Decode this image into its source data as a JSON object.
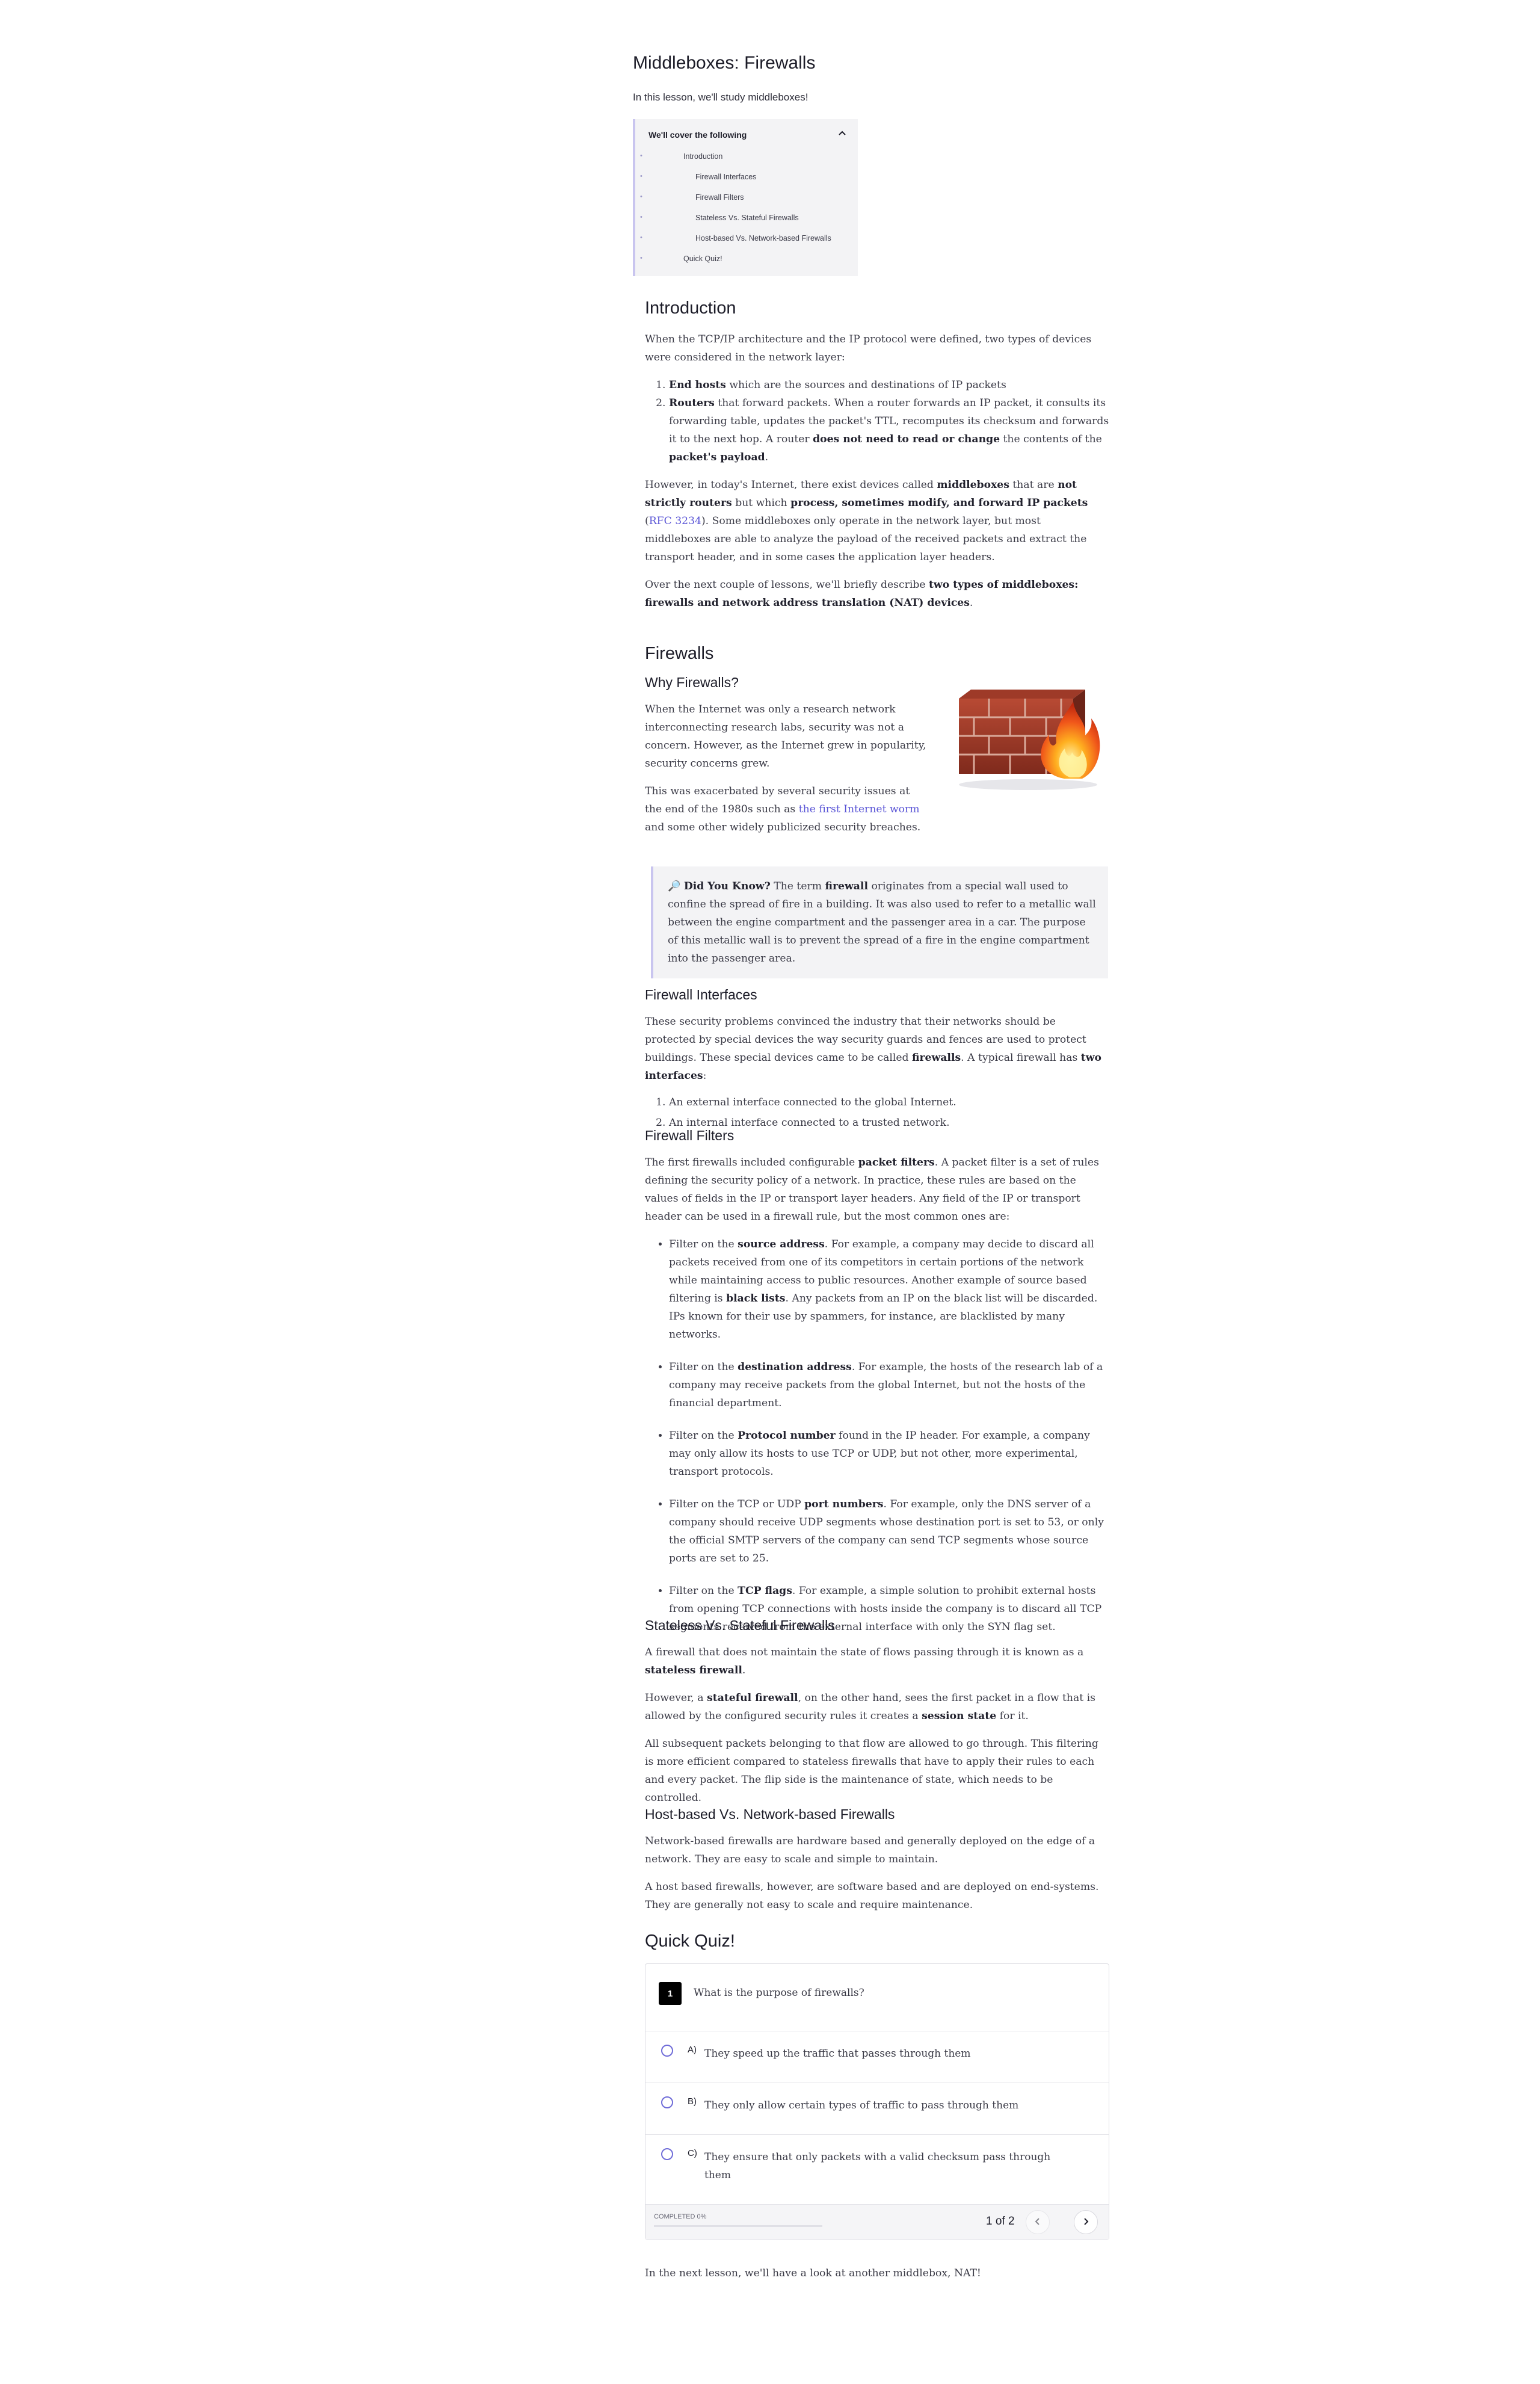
{
  "lesson": {
    "title": "Middleboxes: Firewalls",
    "subtitle": "In this lesson, we'll study middleboxes!"
  },
  "toc": {
    "heading": "We'll cover the following",
    "items": [
      {
        "label": "Introduction",
        "level": 1
      },
      {
        "label": "Firewall Interfaces",
        "level": 2
      },
      {
        "label": "Firewall Filters",
        "level": 2
      },
      {
        "label": "Stateless Vs. Stateful Firewalls",
        "level": 2
      },
      {
        "label": "Host-based Vs. Network-based Firewalls",
        "level": 2
      },
      {
        "label": "Quick Quiz!",
        "level": 1
      }
    ]
  },
  "intro": {
    "heading": "Introduction",
    "p1": "When the TCP/IP architecture and the IP protocol were defined, two types of devices were considered in the network layer:",
    "li1_b": "End hosts",
    "li1": " which are the sources and destinations of IP packets",
    "li2_b": "Routers",
    "li2a": " that forward packets. When a router forwards an IP packet, it consults its forwarding table, updates the packet's TTL, recomputes its checksum and forwards it to the next hop. A router ",
    "li2_b2": "does not need to read or change",
    "li2b": " the contents of the ",
    "li2_b3": "packet's payload",
    "li2c": ".",
    "p2a": "However, in today's Internet, there exist devices called ",
    "p2_b1": "middleboxes",
    "p2b": " that are ",
    "p2_b2": "not strictly routers",
    "p2c": " but which ",
    "p2_b3": "process, sometimes modify, and forward IP packets",
    "p2d": " (",
    "p2_link": "RFC 3234",
    "p2e": "). Some middleboxes only operate in the network layer, but most middleboxes are able to analyze the payload of the received packets and extract the transport header, and in some cases the application layer headers.",
    "p3a": "Over the next couple of lessons, we'll briefly describe ",
    "p3_b": "two types of middleboxes: firewalls and network address translation (NAT) devices",
    "p3b": "."
  },
  "firewalls": {
    "heading": "Firewalls",
    "why_heading": "Why Firewalls?",
    "why_p1": "When the Internet was only a research network interconnecting research labs, security was not a concern. However, as the Internet grew in popularity, security concerns grew.",
    "why_p2a": "This was exacerbated by several security issues at the end of the 1980s such as ",
    "why_link": "the first Internet worm",
    "why_p2b": " and some other widely publicized security breaches.",
    "callout_icon": "magnifier-icon",
    "callout_b1": "Did You Know?",
    "callout_a": " The term ",
    "callout_b2": "firewall",
    "callout_b": " originates from a special wall used to confine the spread of fire in a building. It was also used to refer to a metallic wall between the engine compartment and the passenger area in a car. The purpose of this metallic wall is to prevent the spread of a fire in the engine compartment into the passenger area."
  },
  "interfaces": {
    "heading": "Firewall Interfaces",
    "p1a": "These security problems convinced the industry that their networks should be protected by special devices the way security guards and fences are used to protect buildings. These special devices came to be called ",
    "p1_b1": "firewalls",
    "p1b": ". A typical firewall has ",
    "p1_b2": "two interfaces",
    "p1c": ":",
    "li1": "An external interface connected to the global Internet.",
    "li2": "An internal interface connected to a trusted network."
  },
  "filters": {
    "heading": "Firewall Filters",
    "p1a": "The first firewalls included configurable ",
    "p1_b": "packet filters",
    "p1b": ". A packet filter is a set of rules defining the security policy of a network. In practice, these rules are based on the values of fields in the IP or transport layer headers. Any field of the IP or transport header can be used in a firewall rule, but the most common ones are:",
    "b1a": "Filter on the ",
    "b1_b": "source address",
    "b1b": ". For example, a company may decide to discard all packets received from one of its competitors in certain portions of the network while maintaining access to public resources. Another example of source based filtering is ",
    "b1_b2": "black lists",
    "b1c": ". Any packets from an IP on the black list will be discarded. IPs known for their use by spammers, for instance, are blacklisted by many networks.",
    "b2a": "Filter on the ",
    "b2_b": "destination address",
    "b2b": ". For example, the hosts of the research lab of a company may receive packets from the global Internet, but not the hosts of the financial department.",
    "b3a": "Filter on the ",
    "b3_b": "Protocol number",
    "b3b": " found in the IP header. For example, a company may only allow its hosts to use TCP or UDP, but not other, more experimental, transport protocols.",
    "b4a": "Filter on the TCP or UDP ",
    "b4_b": "port numbers",
    "b4b": ". For example, only the DNS server of a company should receive UDP segments whose destination port is set to 53, or only the official SMTP servers of the company can send TCP segments whose source ports are set to 25.",
    "b5a": "Filter on the ",
    "b5_b": "TCP flags",
    "b5b": ". For example, a simple solution to prohibit external hosts from opening TCP connections with hosts inside the company is to discard all TCP segments received from the external interface with only the SYN flag set."
  },
  "stateful": {
    "heading": "Stateless Vs. Stateful Firewalls",
    "p1a": "A firewall that does not maintain the state of flows passing through it is known as a ",
    "p1_b": "stateless firewall",
    "p1b": ".",
    "p2a": "However, a ",
    "p2_b": "stateful firewall",
    "p2b": ", on the other hand, sees the first packet in a flow that is allowed by the configured security rules it creates a ",
    "p2_b2": "session state",
    "p2c": " for it.",
    "p3": "All subsequent packets belonging to that flow are allowed to go through. This filtering is more efficient compared to stateless firewalls that have to apply their rules to each and every packet. The flip side is the maintenance of state, which needs to be controlled."
  },
  "hostbased": {
    "heading": "Host-based Vs. Network-based Firewalls",
    "p1": "Network-based firewalls are hardware based and generally deployed on the edge of a network. They are easy to scale and simple to maintain.",
    "p2": "A host based firewalls, however, are software based and are deployed on end-systems. They are generally not easy to scale and require maintenance."
  },
  "quiz": {
    "heading": "Quick Quiz!",
    "question_number": "1",
    "question": "What is the purpose of firewalls?",
    "options": [
      {
        "letter": "A)",
        "text": "They speed up the traffic that passes through them"
      },
      {
        "letter": "B)",
        "text": "They only allow certain types of traffic to pass through them"
      },
      {
        "letter": "C)",
        "text": "They ensure that only packets with a valid checksum pass through them"
      }
    ],
    "completed_label": "COMPLETED 0%",
    "progress": 0,
    "pagination": "1 of 2"
  },
  "closing": "In the next lesson, we'll have a look at another middlebox, NAT!"
}
